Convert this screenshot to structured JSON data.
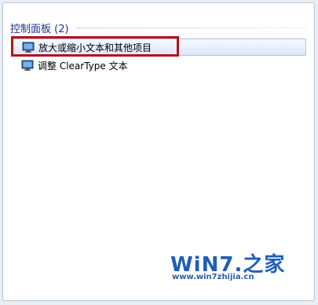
{
  "group": {
    "title": "控制面板 (2)"
  },
  "results": [
    {
      "label": "放大或缩小文本和其他项目",
      "icon": "display-settings-icon",
      "selected": true
    },
    {
      "label": "调整 ClearType 文本",
      "icon": "display-settings-icon",
      "selected": false
    }
  ],
  "watermark": {
    "logo": "WiN7.之家",
    "url": "www.win7zhijia.cn"
  },
  "colors": {
    "group_title": "#1e3287",
    "highlight_border": "#b5121b",
    "selected_bg": "#dbe8f8",
    "watermark": "#1f5fb5"
  }
}
